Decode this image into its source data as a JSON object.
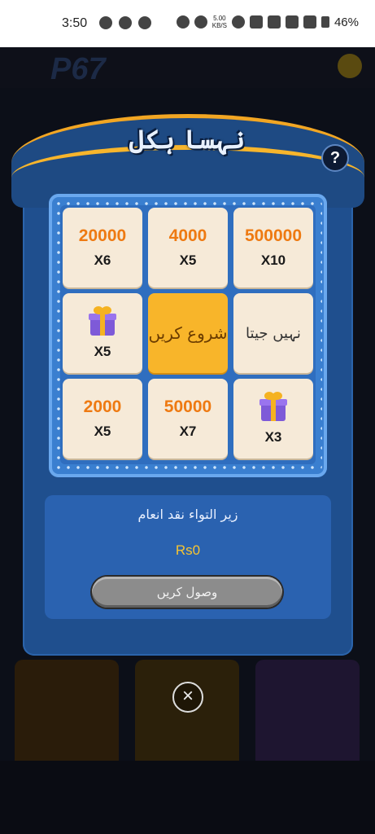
{
  "status_bar": {
    "time": "3:50",
    "speed": "5.00\nKB/S",
    "battery": "46%"
  },
  "background_app": {
    "logo": "P67"
  },
  "modal": {
    "title": "نہسا ہکل",
    "help": "?",
    "grid": [
      {
        "type": "prize",
        "amount": "20000",
        "multiplier": "X6"
      },
      {
        "type": "prize",
        "amount": "4000",
        "multiplier": "X5"
      },
      {
        "type": "prize",
        "amount": "500000",
        "multiplier": "X10"
      },
      {
        "type": "gift",
        "multiplier": "X5"
      },
      {
        "type": "start",
        "label": "شروع کریں"
      },
      {
        "type": "text",
        "label": "نہیں جیتا"
      },
      {
        "type": "prize",
        "amount": "2000",
        "multiplier": "X5"
      },
      {
        "type": "prize",
        "amount": "50000",
        "multiplier": "X7"
      },
      {
        "type": "gift",
        "multiplier": "X3"
      }
    ],
    "cash": {
      "label": "زیر التواء نقد انعام",
      "value": "Rs0",
      "collect_label": "وصول کریں"
    }
  },
  "close": "×"
}
